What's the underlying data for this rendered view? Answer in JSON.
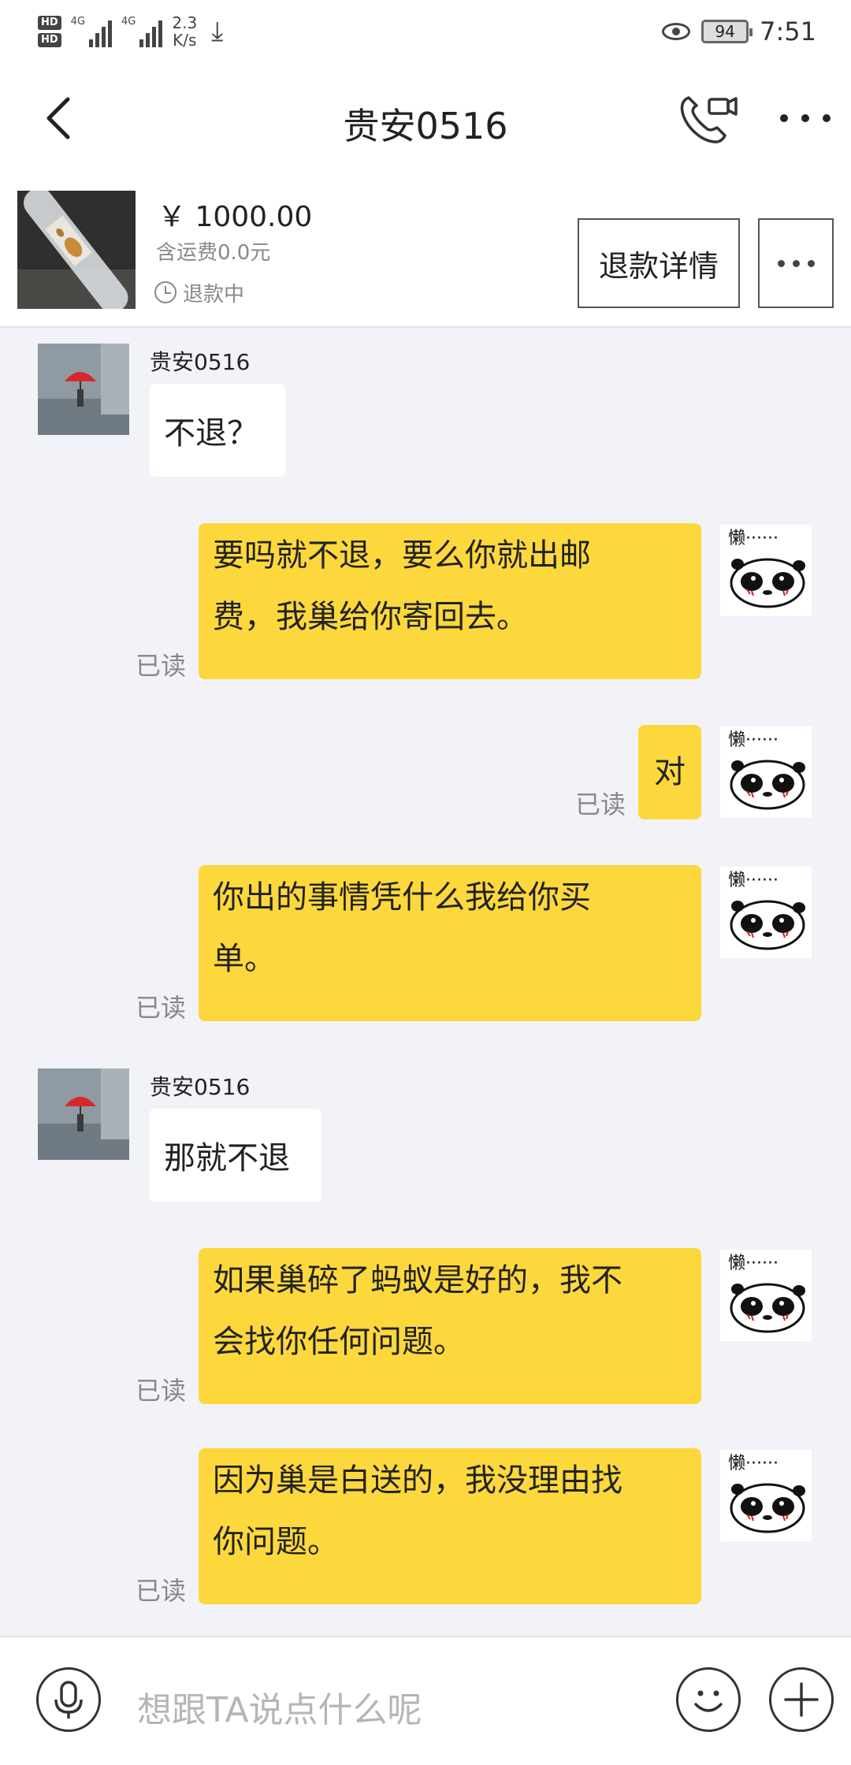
{
  "status_bar": {
    "hd1": "HD",
    "hd2": "HD",
    "network1": "4G",
    "network2": "4G",
    "speed_value": "2.3",
    "speed_unit": "K/s",
    "battery": "94",
    "time": "7:51"
  },
  "header": {
    "title": "贵安0516"
  },
  "product": {
    "price": "￥ 1000.00",
    "shipping": "含运费0.0元",
    "status": "退款中",
    "refund_button": "退款详情"
  },
  "messages": [
    {
      "side": "left",
      "sender": "贵安0516",
      "text": "不退？"
    },
    {
      "side": "right",
      "read": "已读",
      "line1": "要吗就不退，要么你就出邮",
      "line2": "费，我巢给你寄回去。"
    },
    {
      "side": "right",
      "read": "已读",
      "text": "对"
    },
    {
      "side": "right",
      "read": "已读",
      "line1": "你出的事情凭什么我给你买",
      "line2": "单。"
    },
    {
      "side": "left",
      "sender": "贵安0516",
      "text": "那就不退"
    },
    {
      "side": "right",
      "read": "已读",
      "line1": "如果巢碎了蚂蚁是好的，我不",
      "line2": "会找你任何问题。"
    },
    {
      "side": "right",
      "read": "已读",
      "line1": "因为巢是白送的，我没理由找",
      "line2": "你问题。"
    }
  ],
  "input": {
    "placeholder": "想跟TA说点什么呢"
  },
  "colors": {
    "bubble_mine": "#fdd83d",
    "bubble_theirs": "#ffffff",
    "background": "#f2f3f8"
  }
}
